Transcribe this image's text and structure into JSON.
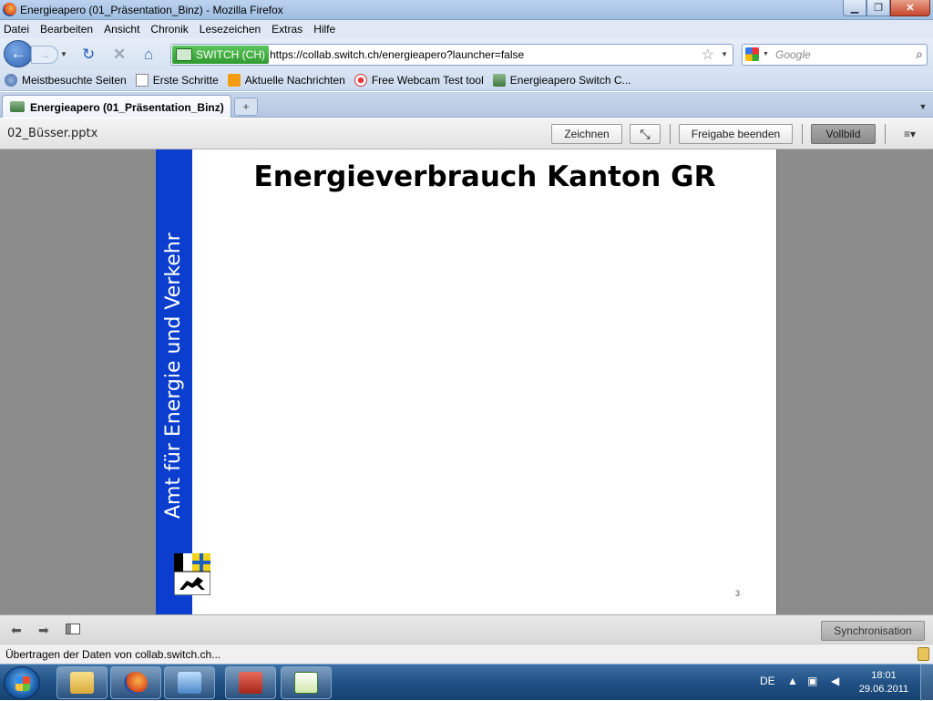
{
  "window": {
    "title": "Energieapero (01_Präsentation_Binz) - Mozilla Firefox",
    "min_label": "▁",
    "max_label": "❐",
    "close_label": "✕"
  },
  "menu": [
    "Datei",
    "Bearbeiten",
    "Ansicht",
    "Chronik",
    "Lesezeichen",
    "Extras",
    "Hilfe"
  ],
  "nav": {
    "site_identity": "SWITCH (CH)",
    "url": "https://collab.switch.ch/energieapero?launcher=false",
    "search_placeholder": "Google"
  },
  "bookmarks": [
    {
      "label": "Meistbesuchte Seiten",
      "icon": "most-visited-icon"
    },
    {
      "label": "Erste Schritte",
      "icon": "page-icon"
    },
    {
      "label": "Aktuelle Nachrichten",
      "icon": "rss-icon"
    },
    {
      "label": "Free Webcam Test tool",
      "icon": "webcam-icon"
    },
    {
      "label": "Energieapero Switch C...",
      "icon": "switch-icon"
    }
  ],
  "tab": {
    "label": "Energieapero (01_Präsentation_Binz)",
    "newtab_glyph": "+"
  },
  "presentation": {
    "document": "02_Büsser.pptx",
    "buttons": {
      "draw": "Zeichnen",
      "end_share": "Freigabe beenden",
      "fullscreen": "Vollbild"
    },
    "menu_glyph": "≡▾"
  },
  "slide": {
    "sidebar_text": "Amt für Energie und Verkehr",
    "title": "Energieverbrauch Kanton GR",
    "page_number": "3"
  },
  "controls": {
    "sync_label": "Synchronisation"
  },
  "status": {
    "text": "Übertragen der Daten von collab.switch.ch..."
  },
  "taskbar": {
    "language": "DE",
    "time": "18:01",
    "date": "29.06.2011"
  }
}
